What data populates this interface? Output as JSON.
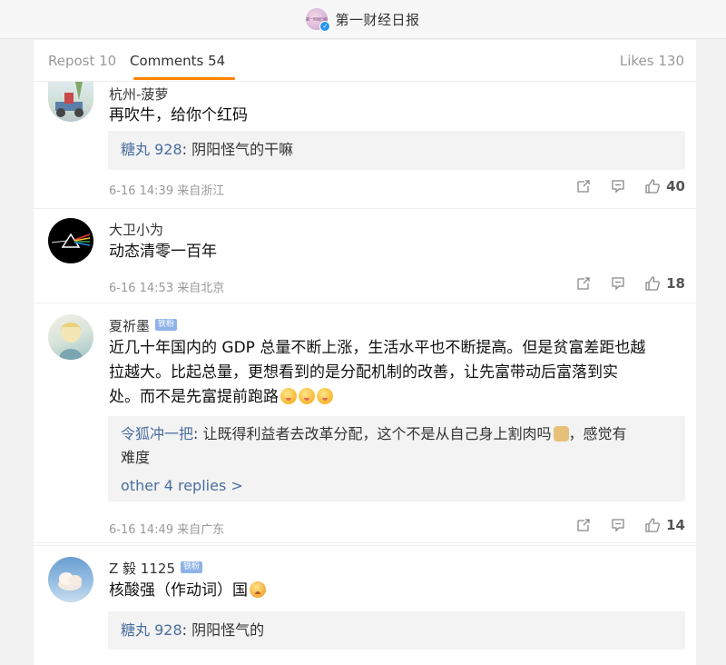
{
  "header": {
    "account_name": "第一财经日报",
    "avatar_text": "第一财经日报"
  },
  "tabs": {
    "repost": "Repost 10",
    "comments": "Comments 54",
    "likes": "Likes 130"
  },
  "comments": [
    {
      "user": "杭州-菠萝",
      "text": "再吹牛，给你个红码",
      "reply_user": "糖丸 928",
      "reply_text": ": 阴阳怪气的干嘛",
      "meta": "6-16 14:39  来自浙江",
      "likes": "40"
    },
    {
      "user": "大卫小为",
      "text": "动态清零一百年",
      "meta": "6-16 14:53  来自北京",
      "likes": "18"
    },
    {
      "user": "夏祈墨",
      "badge": "铁粉",
      "text_lines": [
        "近几十年国内的 GDP 总量不断上涨，生活水平也不断提高。但是贫富差距也越",
        "拉越大。比起总量，更想看到的是分配机制的改善，让先富带动后富落到实",
        "处。而不是先富提前跑路"
      ],
      "reply_user": "令狐冲一把",
      "reply_text_lines": [
        ": 让既得利益者去改革分配，这个不是从自己身上割肉吗",
        "，感觉有",
        "难度"
      ],
      "more_replies": "other 4 replies >",
      "meta": "6-16 14:49  来自广东",
      "likes": "14"
    },
    {
      "user": "Z 毅 1125",
      "badge": "铁粉",
      "text": "核酸强（作动词）国",
      "reply_user": "糖丸 928",
      "reply_text": ": 阴阳怪气的"
    }
  ],
  "icons": [
    "repost-icon",
    "comment-icon",
    "like-icon"
  ],
  "colors": {
    "accent": "#ff8200",
    "link": "#4a6ea0"
  }
}
